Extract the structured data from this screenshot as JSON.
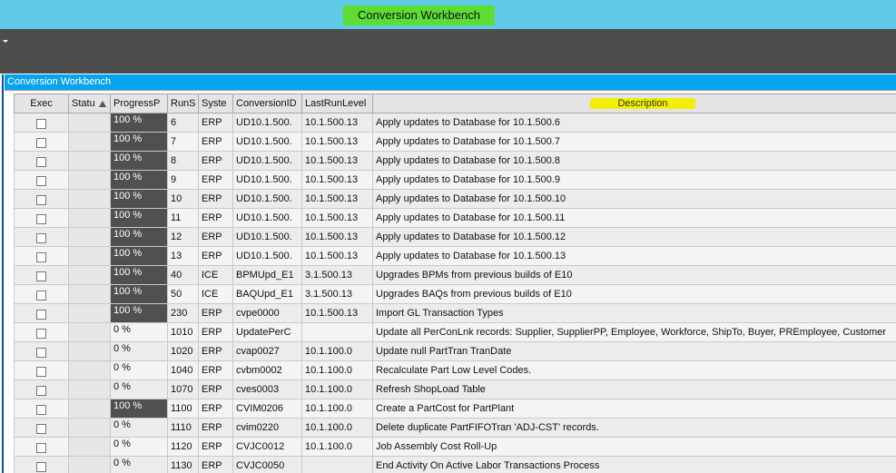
{
  "window": {
    "title": "Conversion Workbench",
    "title_highlight_color": "#5ddd33",
    "titlebar_color": "#60cbe9"
  },
  "panel": {
    "header": "Conversion Workbench",
    "header_color": "#06a4ee"
  },
  "columns": {
    "exec": "Exec",
    "status": "Statu",
    "progress": "ProgressP",
    "runseq": "RunS",
    "system": "Syste",
    "conversion_id": "ConversionID",
    "last_run_level": "LastRunLevel",
    "description": "Description"
  },
  "rows": [
    {
      "exec": false,
      "status": "",
      "progress": "100 %",
      "progress_fraction": 1,
      "run": "6",
      "system": "ERP",
      "cid": "UD10.1.500.",
      "level": "10.1.500.13",
      "desc": "Apply updates to Database for 10.1.500.6"
    },
    {
      "exec": false,
      "status": "",
      "progress": "100 %",
      "progress_fraction": 1,
      "run": "7",
      "system": "ERP",
      "cid": "UD10.1.500.",
      "level": "10.1.500.13",
      "desc": "Apply updates to Database for 10.1.500.7"
    },
    {
      "exec": false,
      "status": "",
      "progress": "100 %",
      "progress_fraction": 1,
      "run": "8",
      "system": "ERP",
      "cid": "UD10.1.500.",
      "level": "10.1.500.13",
      "desc": "Apply updates to Database for 10.1.500.8"
    },
    {
      "exec": false,
      "status": "",
      "progress": "100 %",
      "progress_fraction": 1,
      "run": "9",
      "system": "ERP",
      "cid": "UD10.1.500.",
      "level": "10.1.500.13",
      "desc": "Apply updates to Database for 10.1.500.9"
    },
    {
      "exec": false,
      "status": "",
      "progress": "100 %",
      "progress_fraction": 1,
      "run": "10",
      "system": "ERP",
      "cid": "UD10.1.500.",
      "level": "10.1.500.13",
      "desc": "Apply updates to Database for 10.1.500.10"
    },
    {
      "exec": false,
      "status": "",
      "progress": "100 %",
      "progress_fraction": 1,
      "run": "11",
      "system": "ERP",
      "cid": "UD10.1.500.",
      "level": "10.1.500.13",
      "desc": "Apply updates to Database for 10.1.500.11"
    },
    {
      "exec": false,
      "status": "",
      "progress": "100 %",
      "progress_fraction": 1,
      "run": "12",
      "system": "ERP",
      "cid": "UD10.1.500.",
      "level": "10.1.500.13",
      "desc": "Apply updates to Database for 10.1.500.12"
    },
    {
      "exec": false,
      "status": "",
      "progress": "100 %",
      "progress_fraction": 1,
      "run": "13",
      "system": "ERP",
      "cid": "UD10.1.500.",
      "level": "10.1.500.13",
      "desc": "Apply updates to Database for 10.1.500.13"
    },
    {
      "exec": false,
      "status": "",
      "progress": "100 %",
      "progress_fraction": 1,
      "run": "40",
      "system": "ICE",
      "cid": "BPMUpd_E1",
      "level": "3.1.500.13",
      "desc": "Upgrades BPMs from previous builds of E10"
    },
    {
      "exec": false,
      "status": "",
      "progress": "100 %",
      "progress_fraction": 1,
      "run": "50",
      "system": "ICE",
      "cid": "BAQUpd_E1",
      "level": "3.1.500.13",
      "desc": "Upgrades BAQs from previous builds of E10"
    },
    {
      "exec": false,
      "status": "",
      "progress": "100 %",
      "progress_fraction": 1,
      "run": "230",
      "system": "ERP",
      "cid": "cvpe0000",
      "level": "10.1.500.13",
      "desc": "Import GL Transaction Types"
    },
    {
      "exec": false,
      "status": "",
      "progress": "0 %",
      "progress_fraction": 0,
      "run": "1010",
      "system": "ERP",
      "cid": "UpdatePerC",
      "level": "",
      "desc": "Update all PerConLnk records: Supplier, SupplierPP, Employee, Workforce, ShipTo, Buyer, PREmployee, Customer"
    },
    {
      "exec": false,
      "status": "",
      "progress": "0 %",
      "progress_fraction": 0,
      "run": "1020",
      "system": "ERP",
      "cid": "cvap0027",
      "level": "10.1.100.0",
      "desc": "Update null PartTran TranDate"
    },
    {
      "exec": false,
      "status": "",
      "progress": "0 %",
      "progress_fraction": 0,
      "run": "1040",
      "system": "ERP",
      "cid": "cvbm0002",
      "level": "10.1.100.0",
      "desc": "Recalculate Part Low Level Codes."
    },
    {
      "exec": false,
      "status": "",
      "progress": "0 %",
      "progress_fraction": 0,
      "run": "1070",
      "system": "ERP",
      "cid": "cves0003",
      "level": "10.1.100.0",
      "desc": "Refresh ShopLoad Table"
    },
    {
      "exec": false,
      "status": "",
      "progress": "100 %",
      "progress_fraction": 1,
      "run": "1100",
      "system": "ERP",
      "cid": "CVIM0206",
      "level": "10.1.100.0",
      "desc": "Create a PartCost for PartPlant"
    },
    {
      "exec": false,
      "status": "",
      "progress": "0 %",
      "progress_fraction": 0,
      "run": "1110",
      "system": "ERP",
      "cid": "cvim0220",
      "level": "10.1.100.0",
      "desc": "Delete duplicate PartFIFOTran 'ADJ-CST' records."
    },
    {
      "exec": false,
      "status": "",
      "progress": "0 %",
      "progress_fraction": 0,
      "run": "1120",
      "system": "ERP",
      "cid": "CVJC0012",
      "level": "10.1.100.0",
      "desc": "Job Assembly Cost Roll-Up"
    },
    {
      "exec": false,
      "status": "",
      "progress": "0 %",
      "progress_fraction": 0,
      "run": "1130",
      "system": "ERP",
      "cid": "CVJC0050",
      "level": "",
      "desc": "End Activity On Active Labor Transactions Process"
    }
  ]
}
